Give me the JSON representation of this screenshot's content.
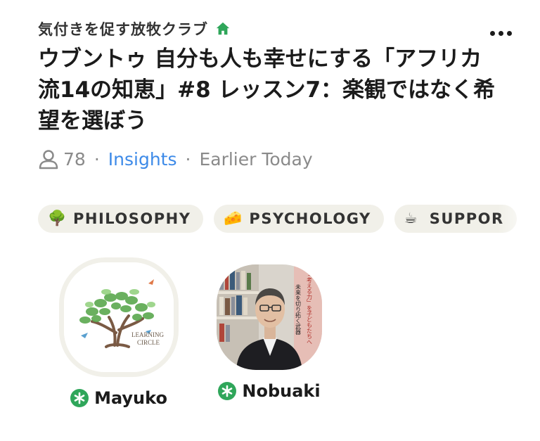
{
  "club": {
    "name": "気付きを促す放牧クラブ",
    "icon": "home-icon",
    "accent": "#2fa65a"
  },
  "room": {
    "title": "ウブントゥ 自分も人も幸せにする「アフリカ流14の知恵」#8 レッスン7：楽観ではなく希望を選ぼう",
    "listener_count": "78",
    "insights_label": "Insights",
    "time_label": "Earlier Today",
    "separator": "·"
  },
  "tags": [
    {
      "emoji": "🌳",
      "label": "PHILOSOPHY"
    },
    {
      "emoji": "🧀",
      "label": "PSYCHOLOGY"
    },
    {
      "emoji": "☕",
      "label": "SUPPOR"
    }
  ],
  "hosts": [
    {
      "name": "Mayuko",
      "logo_text_1": "LEARNING",
      "logo_text_2": "CIRCLE"
    },
    {
      "name": "Nobuaki",
      "book_text_1": "未来を切り拓く武器",
      "book_text_2": "「考える力」を子どもたちへ"
    }
  ],
  "colors": {
    "link": "#3d8ae8",
    "chip_bg": "#f1f0e9",
    "moderator_badge": "#2fa65a"
  }
}
